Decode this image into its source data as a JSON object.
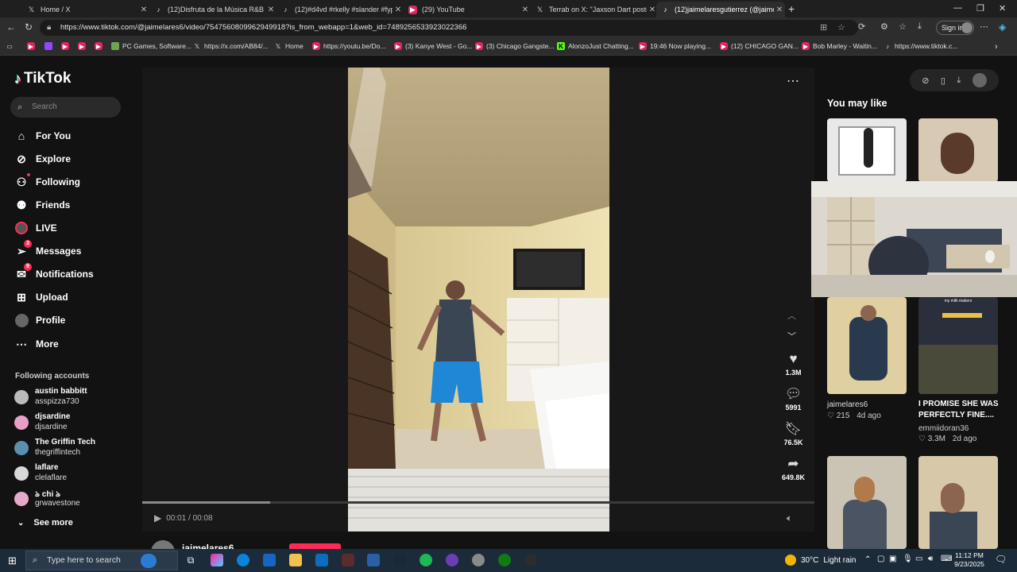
{
  "browser": {
    "tabs": [
      {
        "icon": "x-logo-icon",
        "title": "Home / X"
      },
      {
        "icon": "tiktok-icon",
        "title": "(12)Disfruta de la Música R&B de"
      },
      {
        "icon": "tiktok-icon",
        "title": "(12)#d4vd #rkelly #slander #fyp"
      },
      {
        "icon": "youtube-icon",
        "title": "(29) YouTube"
      },
      {
        "icon": "x-logo-icon",
        "title": "Terrab on X: \"Jaxson Dart postgam"
      },
      {
        "icon": "tiktok-icon",
        "title": "(12)jaimelaresgutierrez (@jaimela"
      }
    ],
    "url": "https://www.tiktok.com/@jaimelares6/video/7547560809962949918?is_from_webapp=1&web_id=7489256533923022366",
    "sign_in": "Sign in",
    "bookmarks": [
      {
        "icon": "youtube-icon",
        "label": ""
      },
      {
        "icon": "twitch-icon",
        "label": ""
      },
      {
        "icon": "youtube-icon",
        "label": ""
      },
      {
        "icon": "youtube-icon",
        "label": ""
      },
      {
        "icon": "games-icon",
        "label": "PC Games, Software..."
      },
      {
        "icon": "x-logo-icon",
        "label": "https://x.com/AB84/..."
      },
      {
        "icon": "x-logo-icon",
        "label": "Home"
      },
      {
        "icon": "youtube-icon",
        "label": "https://youtu.be/Do..."
      },
      {
        "icon": "youtube-icon",
        "label": "(3) Kanye West - Go..."
      },
      {
        "icon": "youtube-icon",
        "label": "(3) Chicago Gangste..."
      },
      {
        "icon": "kick-icon",
        "label": "AlonzoJust Chatting..."
      },
      {
        "icon": "youtube-icon",
        "label": "19:46 Now playing..."
      },
      {
        "icon": "youtube-icon",
        "label": "(12) CHICAGO GAN..."
      },
      {
        "icon": "youtube-icon",
        "label": "Bob Marley - Waitin..."
      },
      {
        "icon": "tiktok-icon",
        "label": "https://www.tiktok.c..."
      }
    ]
  },
  "tiktok": {
    "logo": "TikTok",
    "search_placeholder": "Search",
    "nav": [
      {
        "icon": "home-icon",
        "label": "For You",
        "badge": ""
      },
      {
        "icon": "compass-icon",
        "label": "Explore",
        "badge": ""
      },
      {
        "icon": "following-icon",
        "label": "Following",
        "badge": ""
      },
      {
        "icon": "friends-icon",
        "label": "Friends",
        "badge": ""
      },
      {
        "icon": "live-icon",
        "label": "LIVE",
        "badge": ""
      },
      {
        "icon": "messages-icon",
        "label": "Messages",
        "badge": "3"
      },
      {
        "icon": "notifications-icon",
        "label": "Notifications",
        "badge": "9"
      },
      {
        "icon": "upload-icon",
        "label": "Upload",
        "badge": ""
      },
      {
        "icon": "profile-icon",
        "label": "Profile",
        "badge": ""
      },
      {
        "icon": "more-icon",
        "label": "More",
        "badge": ""
      }
    ],
    "following_title": "Following accounts",
    "following": [
      {
        "name": "austin babbitt",
        "handle": "asspizza730"
      },
      {
        "name": "djsardine",
        "handle": "djsardine"
      },
      {
        "name": "The Griffin Tech",
        "handle": "thegriffintech"
      },
      {
        "name": "laflare",
        "handle": "clelaflare"
      },
      {
        "name": "ঌ chi ঌ",
        "handle": "grwavestone"
      }
    ],
    "see_more": "See more",
    "video": {
      "time": "00:01 / 00:08",
      "progress": 0.19,
      "author": "jaimelares6",
      "likes": "1.3M",
      "comments": "5991",
      "saves": "76.5K",
      "shares": "649.8K"
    },
    "you_may_like": "You may like",
    "suggestions": [
      {
        "caption": "jaimelares6",
        "likes": "215",
        "age": "4d ago"
      },
      {
        "caption": "I PROMISE SHE WAS PERFECTLY FINE....",
        "author": "emmiidoran36",
        "likes": "3.3M",
        "age": "2d ago"
      }
    ],
    "thumb_text": "my milk makers"
  },
  "taskbar": {
    "search_placeholder": "Type here to search",
    "weather_temp": "30°C",
    "weather_desc": "Light rain",
    "time": "11:12 PM",
    "date": "9/23/2025"
  }
}
